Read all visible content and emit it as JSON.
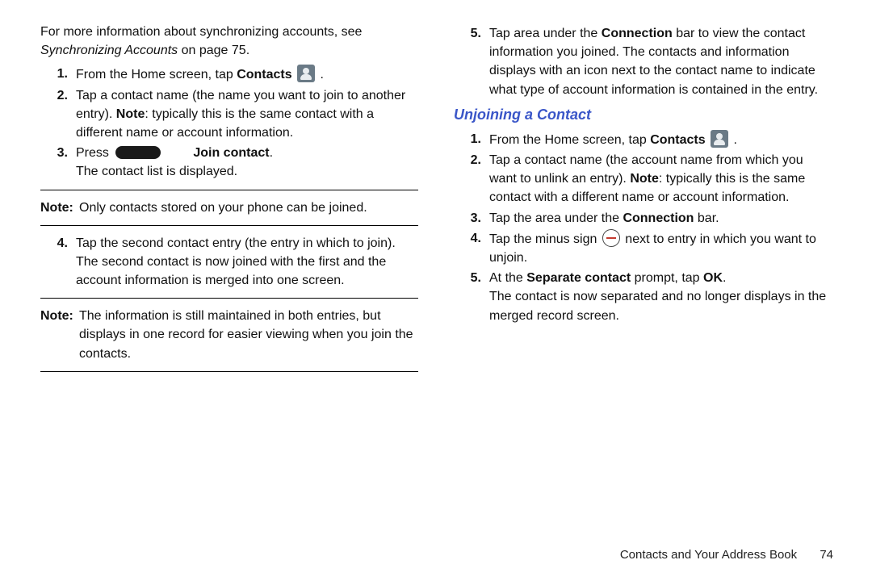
{
  "left": {
    "intro_a": "For more information about synchronizing accounts, see ",
    "intro_xref": "Synchronizing Accounts",
    "intro_b": " on page 75.",
    "s1a": "From the Home screen, tap ",
    "s1b": "Contacts",
    "s1c": " .",
    "s2a": "Tap a contact name (the name you want to join to another entry). ",
    "s2b": "Note",
    "s2c": ": typically this is the same contact with a different name or account information.",
    "s3a": "Press ",
    "s3b": "Join contact",
    "s3c": ".",
    "s3d": "The contact list is displayed.",
    "note1_label": "Note:",
    "note1_body": "Only contacts stored on your phone can be joined.",
    "s4": "Tap the second contact entry (the entry in which to join). The second contact is now joined with the first and the account information is merged into one screen.",
    "note2_label": "Note:",
    "note2_body": "The information is still maintained in both entries, but displays in one record for easier viewing when you join the contacts.",
    "s5a": "Tap area under the ",
    "s5b": "Connection",
    "s5c": " bar to view the contact information you joined. The contacts and information displays with an icon next to the contact name to indicate what type of account information is contained in the entry."
  },
  "right": {
    "heading": "Unjoining a Contact",
    "s1a": "From the Home screen, tap ",
    "s1b": "Contacts",
    "s1c": " .",
    "s2a": "Tap a contact name (the account name from which you want to unlink an entry). ",
    "s2b": "Note",
    "s2c": ": typically this is the same contact with a different name or account information.",
    "s3a": "Tap the area under the ",
    "s3b": "Connection",
    "s3c": " bar.",
    "s4a": "Tap the minus sign ",
    "s4b": " next to entry in which you want to unjoin.",
    "s5a": "At the ",
    "s5b": "Separate contact",
    "s5c": " prompt, tap ",
    "s5d": "OK",
    "s5e": ".",
    "s5f": "The contact is now separated and no longer displays in the merged record screen."
  },
  "nums": {
    "n1": "1.",
    "n2": "2.",
    "n3": "3.",
    "n4": "4.",
    "n5": "5."
  },
  "footer": {
    "section": "Contacts and Your Address Book",
    "page": "74"
  }
}
